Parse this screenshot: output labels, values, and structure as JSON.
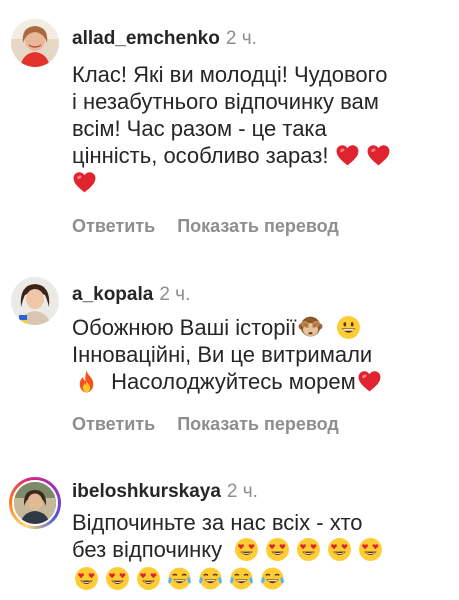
{
  "comments": [
    {
      "username": "allad_emchenko",
      "time": "2 ч.",
      "lines": [
        "Клас! Які ви молодці! Чудового",
        "і незабутнього відпочинку вам",
        "всім! Час разом - це така",
        "цінність, особливо зараз!"
      ],
      "emoji_end_line3": [
        "red-heart",
        "red-heart"
      ],
      "emoji_line4": [
        "red-heart"
      ],
      "reply_label": "Ответить",
      "translate_label": "Показать перевод"
    },
    {
      "username": "a_kopala",
      "time": "2 ч.",
      "lines": [
        "Обожнюю Ваші історії",
        "Інноваційні, Ви це витримали",
        "Насолоджуйтесь морем"
      ],
      "emoji_line0": [
        "see-no-evil-monkey",
        "grinning-face"
      ],
      "emoji_line2_start": [
        "fire"
      ],
      "emoji_line2_end": [
        "red-heart"
      ],
      "reply_label": "Ответить",
      "translate_label": "Показать перевод"
    },
    {
      "username": "ibeloshkurskaya",
      "time": "2 ч.",
      "lines": [
        "Відпочиньте за нас всіх - хто",
        "без відпочинку"
      ],
      "emoji_line1": [
        "heart-eyes",
        "heart-eyes",
        "heart-eyes",
        "heart-eyes",
        "heart-eyes"
      ],
      "emoji_line2": [
        "heart-eyes",
        "heart-eyes",
        "heart-eyes",
        "tears-of-joy",
        "tears-of-joy",
        "tears-of-joy",
        "tears-of-joy"
      ]
    }
  ],
  "colors": {
    "text": "#262626",
    "secondary": "#8e8e8e",
    "heart": "#e0242f"
  }
}
